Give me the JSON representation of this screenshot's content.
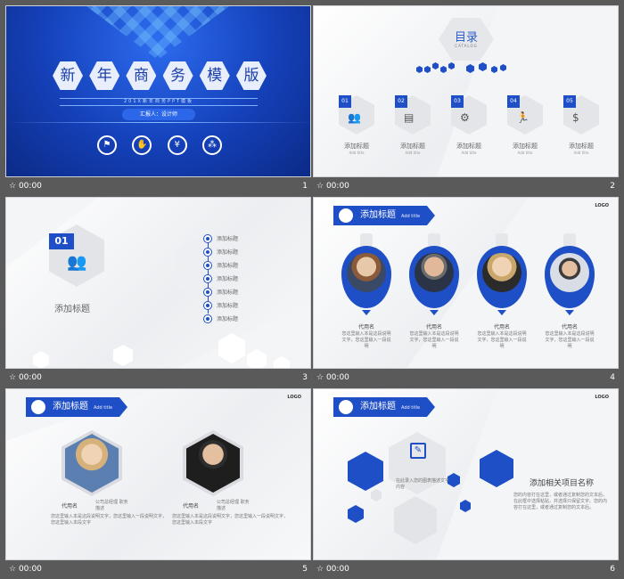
{
  "slides": [
    {
      "time": "00:00",
      "num": "1",
      "title_chars": [
        "新",
        "年",
        "商",
        "务",
        "模",
        "版"
      ],
      "subtitle": "201X新年商务PPT模板",
      "reporter": "汇报人：设计师"
    },
    {
      "time": "00:00",
      "num": "2",
      "title": "目录",
      "title_en": "CATALOG",
      "items": [
        {
          "n": "01",
          "label": "添加标题",
          "sub": "Add title"
        },
        {
          "n": "02",
          "label": "添加标题",
          "sub": "Add title"
        },
        {
          "n": "03",
          "label": "添加标题",
          "sub": "Add title"
        },
        {
          "n": "04",
          "label": "添加标题",
          "sub": "Add title"
        },
        {
          "n": "05",
          "label": "添加标题",
          "sub": "Add title"
        }
      ]
    },
    {
      "time": "00:00",
      "num": "3",
      "n": "01",
      "title": "添加标题",
      "items": [
        "添加标题",
        "添加标题",
        "添加标题",
        "添加标题",
        "添加标题",
        "添加标题",
        "添加标题"
      ]
    },
    {
      "time": "00:00",
      "num": "4",
      "tag": "添加标题",
      "tag_sub": "Add title",
      "logo": "LOGO",
      "people": [
        {
          "name": "代用名",
          "desc": "您这里输入本是这段说明文字，您这里输入一段说明"
        },
        {
          "name": "代用名",
          "desc": "您这里输入本是这段说明文字，您这里输入一段说明"
        },
        {
          "name": "代用名",
          "desc": "您这里输入本是这段说明文字，您这里输入一段说明"
        },
        {
          "name": "代用名",
          "desc": "您这里输入本是这段说明文字，您这里输入一段说明"
        }
      ]
    },
    {
      "time": "00:00",
      "num": "5",
      "tag": "添加标题",
      "tag_sub": "Add title",
      "logo": "LOGO",
      "people": [
        {
          "name": "代用名",
          "role": "公司总经理 职务描述",
          "desc": "您这里输入本是这段说明文字，您这里输入一段说明文字，您这里输入本段文字"
        },
        {
          "name": "代用名",
          "role": "公司总经理 职务描述",
          "desc": "您这里输入本是这段说明文字，您这里输入一段说明文字，您这里输入本段文字"
        }
      ]
    },
    {
      "time": "00:00",
      "num": "6",
      "tag": "添加标题",
      "tag_sub": "Add title",
      "logo": "LOGO",
      "center_text": "在此录入您的图表描述文字内容",
      "heading": "添加相关项目名称",
      "body": "您的内容打在这里，或者通过复制您的文本后，在此框中选择粘贴，并选择只保留文字。您的内容打在这里，或者通过复制您的文本后。"
    }
  ]
}
